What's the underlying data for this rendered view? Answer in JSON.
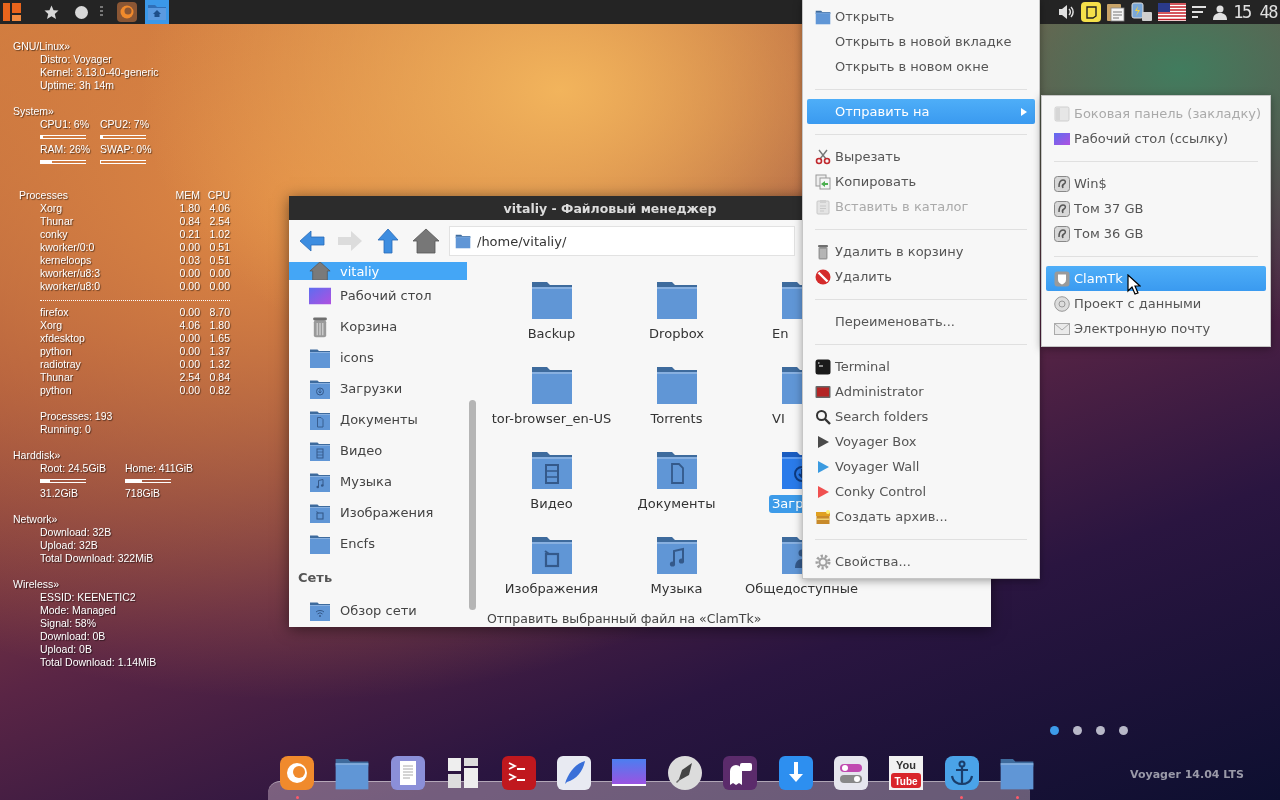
{
  "top_panel": {
    "launchers": [
      {
        "kind": "firefox",
        "selected": false
      },
      {
        "kind": "home-folder",
        "selected": true
      }
    ],
    "clock": "15 48"
  },
  "conky": {
    "sections": [
      {
        "kind": "lines",
        "title": "GNU/Linux»",
        "lines": [
          "Distro: Voyager",
          "Kernel: 3.13.0-40-generic",
          "Uptime: 3h 14m"
        ]
      },
      {
        "kind": "meters",
        "title": "System»",
        "meters": [
          {
            "label": "CPU1: 6%",
            "level": 0.06
          },
          {
            "label": "CPU2: 7%",
            "level": 0.07
          },
          {
            "label": "RAM: 26%",
            "level": 0.26
          },
          {
            "label": "SWAP: 0%",
            "level": 0
          }
        ]
      },
      {
        "kind": "processes",
        "title": "Processes",
        "columns": [
          "MEM",
          "CPU"
        ],
        "groups": [
          [
            {
              "name": "Xorg",
              "mem": "1.80",
              "cpu": "4.06"
            },
            {
              "name": "Thunar",
              "mem": "0.84",
              "cpu": "2.54"
            },
            {
              "name": "conky",
              "mem": "0.21",
              "cpu": "1.02"
            },
            {
              "name": "kworker/0:0",
              "mem": "0.00",
              "cpu": "0.51"
            },
            {
              "name": "kerneloops",
              "mem": "0.03",
              "cpu": "0.51"
            },
            {
              "name": "kworker/u8:3",
              "mem": "0.00",
              "cpu": "0.00"
            },
            {
              "name": "kworker/u8:0",
              "mem": "0.00",
              "cpu": "0.00"
            }
          ],
          [
            {
              "name": "firefox",
              "mem": "0.00",
              "cpu": "8.70"
            },
            {
              "name": "Xorg",
              "mem": "4.06",
              "cpu": "1.80"
            },
            {
              "name": "xfdesktop",
              "mem": "0.00",
              "cpu": "1.65"
            },
            {
              "name": "python",
              "mem": "0.00",
              "cpu": "1.37"
            },
            {
              "name": "radiotray",
              "mem": "0.00",
              "cpu": "1.32"
            },
            {
              "name": "Thunar",
              "mem": "2.54",
              "cpu": "0.84"
            },
            {
              "name": "python",
              "mem": "0.00",
              "cpu": "0.82"
            }
          ]
        ],
        "lines": [
          "Processes: 193",
          "Running: 0"
        ]
      },
      {
        "kind": "disks",
        "title": "Harddisk»",
        "disks": [
          {
            "label": "Root: 24.5GiB",
            "level": 0.22,
            "size": "31.2GiB"
          },
          {
            "label": "Home: 411GiB",
            "level": 0.36,
            "size": "718GiB"
          }
        ]
      },
      {
        "kind": "lines",
        "title": "Network»",
        "lines": [
          "Download: 32B",
          "Upload: 32B",
          "Total Download: 322MiB"
        ]
      },
      {
        "kind": "lines",
        "title": "Wireless»",
        "lines": [
          "ESSID: KEENETIC2",
          "Mode: Managed",
          "Signal: 58%",
          "Download: 0B",
          "Upload: 0B",
          "Total Download: 1.14MiB"
        ]
      }
    ]
  },
  "file_manager": {
    "title": "vitaliy - Файловый менеджер",
    "toolbar": [
      {
        "kind": "back",
        "disabled": false
      },
      {
        "kind": "forward",
        "disabled": true
      },
      {
        "kind": "up",
        "disabled": false
      },
      {
        "kind": "home",
        "disabled": false
      }
    ],
    "path": "/home/vitaliy/",
    "sidebar": {
      "sections": [
        {
          "items": [
            {
              "label": "vitaliy",
              "kind": "home",
              "selected": true
            },
            {
              "label": "Рабочий стол",
              "kind": "desktop",
              "selected": false
            },
            {
              "label": "Корзина",
              "kind": "trash",
              "selected": false
            },
            {
              "label": "icons",
              "kind": "folder",
              "selected": false
            },
            {
              "label": "Загрузки",
              "kind": "download",
              "selected": false
            },
            {
              "label": "Документы",
              "kind": "document",
              "selected": false
            },
            {
              "label": "Видео",
              "kind": "video",
              "selected": false
            },
            {
              "label": "Музыка",
              "kind": "music",
              "selected": false
            },
            {
              "label": "Изображения",
              "kind": "pictures",
              "selected": false
            },
            {
              "label": "Encfs",
              "kind": "folder",
              "selected": false
            }
          ]
        },
        {
          "title": "Сеть",
          "items": [
            {
              "label": "Обзор сети",
              "kind": "network",
              "selected": false
            }
          ]
        }
      ]
    },
    "items": [
      {
        "label": "Backup",
        "kind": "folder",
        "selected": false
      },
      {
        "label": "Dropbox",
        "kind": "folder",
        "selected": false
      },
      {
        "label": "En",
        "kind": "folder",
        "selected": false
      },
      {
        "label": "tor-browser_en-US",
        "kind": "folder",
        "selected": false
      },
      {
        "label": "Torrents",
        "kind": "folder",
        "selected": false
      },
      {
        "label": "VI",
        "kind": "folder",
        "selected": false
      },
      {
        "label": "Видео",
        "kind": "video",
        "selected": false
      },
      {
        "label": "Документы",
        "kind": "document",
        "selected": false
      },
      {
        "label": "Загр",
        "kind": "download",
        "selected": true
      },
      {
        "label": "Изображения",
        "kind": "pictures",
        "selected": false
      },
      {
        "label": "Музыка",
        "kind": "music",
        "selected": false
      },
      {
        "label": "Общедоступные",
        "kind": "public",
        "selected": false
      }
    ],
    "status": "Отправить выбранный файл на «ClamTk»"
  },
  "context_menu": {
    "items": [
      {
        "kind": "folder",
        "label": "Открыть",
        "selected": false,
        "disabled": false,
        "submenu": false
      },
      {
        "kind": "plain",
        "label": "Открыть в новой вкладке",
        "selected": false,
        "disabled": false,
        "submenu": false
      },
      {
        "kind": "plain",
        "label": "Открыть в новом окне",
        "selected": false,
        "disabled": false,
        "submenu": false
      },
      {
        "kind": "separator"
      },
      {
        "kind": "plain",
        "label": "Отправить на",
        "selected": true,
        "disabled": false,
        "submenu": true
      },
      {
        "kind": "separator"
      },
      {
        "kind": "scissors",
        "label": "Вырезать",
        "selected": false,
        "disabled": false,
        "submenu": false
      },
      {
        "kind": "copy",
        "label": "Копировать",
        "selected": false,
        "disabled": false,
        "submenu": false
      },
      {
        "kind": "paste",
        "label": "Вставить в каталог",
        "selected": false,
        "disabled": true,
        "submenu": false
      },
      {
        "kind": "separator"
      },
      {
        "kind": "trash",
        "label": "Удалить в корзину",
        "selected": false,
        "disabled": false,
        "submenu": false
      },
      {
        "kind": "delete",
        "label": "Удалить",
        "selected": false,
        "disabled": false,
        "submenu": false
      },
      {
        "kind": "separator"
      },
      {
        "kind": "plain",
        "label": "Переименовать...",
        "selected": false,
        "disabled": false,
        "submenu": false
      },
      {
        "kind": "separator"
      },
      {
        "kind": "terminal",
        "label": "Terminal",
        "selected": false,
        "disabled": false,
        "submenu": false
      },
      {
        "kind": "admin",
        "label": "Administrator",
        "selected": false,
        "disabled": false,
        "submenu": false
      },
      {
        "kind": "search",
        "label": "Search folders",
        "selected": false,
        "disabled": false,
        "submenu": false
      },
      {
        "kind": "play",
        "color": "#4a4a4a",
        "label": "Voyager Box",
        "selected": false,
        "disabled": false,
        "submenu": false
      },
      {
        "kind": "play",
        "color": "#3a9ae0",
        "label": "Voyager Wall",
        "selected": false,
        "disabled": false,
        "submenu": false
      },
      {
        "kind": "play",
        "color": "#f05050",
        "label": "Conky Control",
        "selected": false,
        "disabled": false,
        "submenu": false
      },
      {
        "kind": "archive",
        "label": "Создать архив...",
        "selected": false,
        "disabled": false,
        "submenu": false
      },
      {
        "kind": "separator"
      },
      {
        "kind": "gear",
        "label": "Свойства...",
        "selected": false,
        "disabled": false,
        "submenu": false
      }
    ]
  },
  "submenu": {
    "items": [
      {
        "kind": "panel",
        "label": "Боковая панель (закладку)",
        "selected": false,
        "disabled": true
      },
      {
        "kind": "desktop",
        "label": "Рабочий стол (ссылку)",
        "selected": false,
        "disabled": false
      },
      {
        "kind": "separator"
      },
      {
        "kind": "drive",
        "label": "Win$",
        "selected": false,
        "disabled": false
      },
      {
        "kind": "drive",
        "label": "Том 37 GB",
        "selected": false,
        "disabled": false
      },
      {
        "kind": "drive",
        "label": "Том 36 GB",
        "selected": false,
        "disabled": false
      },
      {
        "kind": "separator"
      },
      {
        "kind": "shield",
        "label": "ClamTk",
        "selected": true,
        "disabled": false
      },
      {
        "kind": "disc",
        "label": "Проект с данными",
        "selected": false,
        "disabled": false
      },
      {
        "kind": "mail",
        "label": "Электронную почту",
        "selected": false,
        "disabled": false
      }
    ]
  },
  "dock": {
    "items": [
      {
        "kind": "firefox",
        "running": true
      },
      {
        "kind": "folder",
        "running": false
      },
      {
        "kind": "document",
        "running": false
      },
      {
        "kind": "tiles",
        "running": false
      },
      {
        "kind": "terminal",
        "running": false
      },
      {
        "kind": "quill",
        "running": false
      },
      {
        "kind": "wallpaper",
        "running": false
      },
      {
        "kind": "rocket",
        "running": false
      },
      {
        "kind": "chat",
        "running": false
      },
      {
        "kind": "download",
        "running": false
      },
      {
        "kind": "toggles",
        "running": false
      },
      {
        "kind": "youtube",
        "lines": [
          "You",
          "Tube"
        ],
        "running": false
      },
      {
        "kind": "anchor",
        "running": true
      },
      {
        "kind": "folder",
        "running": true
      }
    ]
  },
  "pager": [
    {
      "selected": true
    },
    {
      "selected": false
    },
    {
      "selected": false
    },
    {
      "selected": false
    }
  ],
  "version_label": "Voyager 14.04 LTS"
}
